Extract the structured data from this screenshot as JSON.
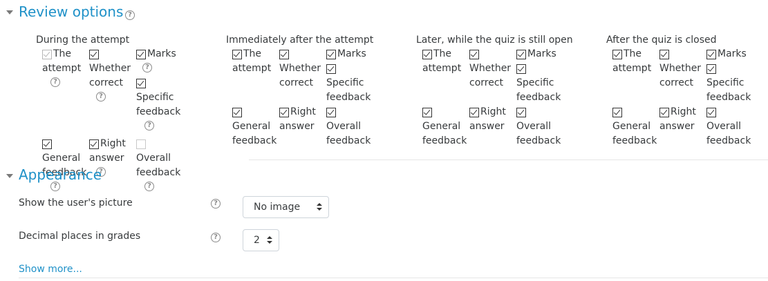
{
  "review_options": {
    "title": "Review options",
    "columns": [
      {
        "title": "During the attempt",
        "options": [
          {
            "line1": "The",
            "line2": "attempt",
            "state": "checked-disabled",
            "help": true
          },
          {
            "line1": "Whether",
            "line2": "correct",
            "state": "checked",
            "help": true
          },
          {
            "line1": "Marks",
            "line2": "",
            "state": "checked",
            "help": true
          },
          {
            "line1": "Specific",
            "line2": "feedback",
            "state": "checked",
            "help": true
          },
          {
            "line1": "General",
            "line2": "feedback",
            "state": "checked",
            "help": true
          },
          {
            "line1": "Right",
            "line2": "answer",
            "state": "checked",
            "help": true
          },
          {
            "line1": "Overall",
            "line2": "feedback",
            "state": "unchecked-disabled",
            "help": true
          }
        ]
      },
      {
        "title": "Immediately after the attempt",
        "options": [
          {
            "line1": "The",
            "line2": "attempt",
            "state": "checked"
          },
          {
            "line1": "Whether",
            "line2": "correct",
            "state": "checked"
          },
          {
            "line1": "Marks",
            "line2": "",
            "state": "checked"
          },
          {
            "line1": "Specific",
            "line2": "feedback",
            "state": "checked"
          },
          {
            "line1": "General",
            "line2": "feedback",
            "state": "checked"
          },
          {
            "line1": "Right",
            "line2": "answer",
            "state": "checked"
          },
          {
            "line1": "Overall",
            "line2": "feedback",
            "state": "checked"
          }
        ]
      },
      {
        "title": "Later, while the quiz is still open",
        "options": [
          {
            "line1": "The",
            "line2": "attempt",
            "state": "checked"
          },
          {
            "line1": "Whether",
            "line2": "correct",
            "state": "checked"
          },
          {
            "line1": "Marks",
            "line2": "",
            "state": "checked"
          },
          {
            "line1": "Specific",
            "line2": "feedback",
            "state": "checked"
          },
          {
            "line1": "General",
            "line2": "feedback",
            "state": "checked"
          },
          {
            "line1": "Right",
            "line2": "answer",
            "state": "checked"
          },
          {
            "line1": "Overall",
            "line2": "feedback",
            "state": "checked"
          }
        ]
      },
      {
        "title": "After the quiz is closed",
        "options": [
          {
            "line1": "The",
            "line2": "attempt",
            "state": "checked"
          },
          {
            "line1": "Whether",
            "line2": "correct",
            "state": "checked"
          },
          {
            "line1": "Marks",
            "line2": "",
            "state": "checked"
          },
          {
            "line1": "Specific",
            "line2": "feedback",
            "state": "checked"
          },
          {
            "line1": "General",
            "line2": "feedback",
            "state": "checked"
          },
          {
            "line1": "Right",
            "line2": "answer",
            "state": "checked"
          },
          {
            "line1": "Overall",
            "line2": "feedback",
            "state": "checked"
          }
        ]
      }
    ]
  },
  "appearance": {
    "title": "Appearance",
    "fields": [
      {
        "label": "Show the user's picture",
        "value": "No image"
      },
      {
        "label": "Decimal places in grades",
        "value": "2"
      }
    ],
    "show_more": "Show more..."
  },
  "icons": {
    "help": "question-circle-icon",
    "expand": "caret-down-icon"
  },
  "colors": {
    "accent": "#1f91c8",
    "text": "#373a3c"
  }
}
